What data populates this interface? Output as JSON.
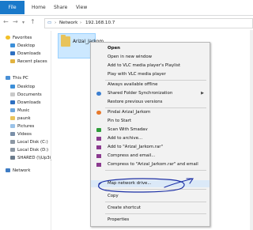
{
  "ribbon": {
    "file_label": "File",
    "tabs": [
      "Home",
      "Share",
      "View"
    ]
  },
  "address": {
    "crumbs": [
      "Network",
      "192.168.10.7"
    ]
  },
  "nav": {
    "items": [
      {
        "label": "Favorites",
        "icon": "star-icon"
      },
      {
        "label": "Desktop",
        "icon": "desktop-icon"
      },
      {
        "label": "Downloads",
        "icon": "downloads-icon"
      },
      {
        "label": "Recent places",
        "icon": "recent-places-icon"
      },
      {
        "label": "This PC",
        "icon": "computer-icon"
      },
      {
        "label": "Desktop",
        "icon": "desktop-icon"
      },
      {
        "label": "Documents",
        "icon": "documents-icon"
      },
      {
        "label": "Downloads",
        "icon": "downloads-icon"
      },
      {
        "label": "Music",
        "icon": "music-icon"
      },
      {
        "label": "paunk",
        "icon": "folder-icon"
      },
      {
        "label": "Pictures",
        "icon": "pictures-icon"
      },
      {
        "label": "Videos",
        "icon": "videos-icon"
      },
      {
        "label": "Local Disk (C:)",
        "icon": "drive-icon"
      },
      {
        "label": "Local Disk (D:)",
        "icon": "drive-icon"
      },
      {
        "label": "SHARED (\\\\Up3i_itco",
        "icon": "network-drive-icon"
      },
      {
        "label": "Network",
        "icon": "network-icon"
      }
    ]
  },
  "folder": {
    "label": "Arizal_Jarkom"
  },
  "menu": {
    "items": [
      {
        "label": "Open",
        "bold": true
      },
      {
        "label": "Open in new window"
      },
      {
        "label": "Add to VLC media player's Playlist"
      },
      {
        "label": "Play with VLC media player"
      },
      {
        "label": "Always available offline"
      },
      {
        "label": "Shared Folder Synchronization",
        "arrow": "▶"
      },
      {
        "label": "Restore previous versions"
      },
      {
        "label": "Pindai Arizal_Jarkom"
      },
      {
        "label": "Pin to Start"
      },
      {
        "label": "Scan With Smadav"
      },
      {
        "label": "Add to archive..."
      },
      {
        "label": "Add to \"Arizal_Jarkom.rar\""
      },
      {
        "label": "Compress and email..."
      },
      {
        "label": "Compress to \"Arizal_Jarkom.rar\" and email"
      },
      {
        "label": "Map network drive..."
      },
      {
        "label": "Copy"
      },
      {
        "label": "Create shortcut"
      },
      {
        "label": "Properties"
      }
    ]
  },
  "colors": {
    "accent": "#1979ca",
    "annotation": "#1b2fa5"
  }
}
